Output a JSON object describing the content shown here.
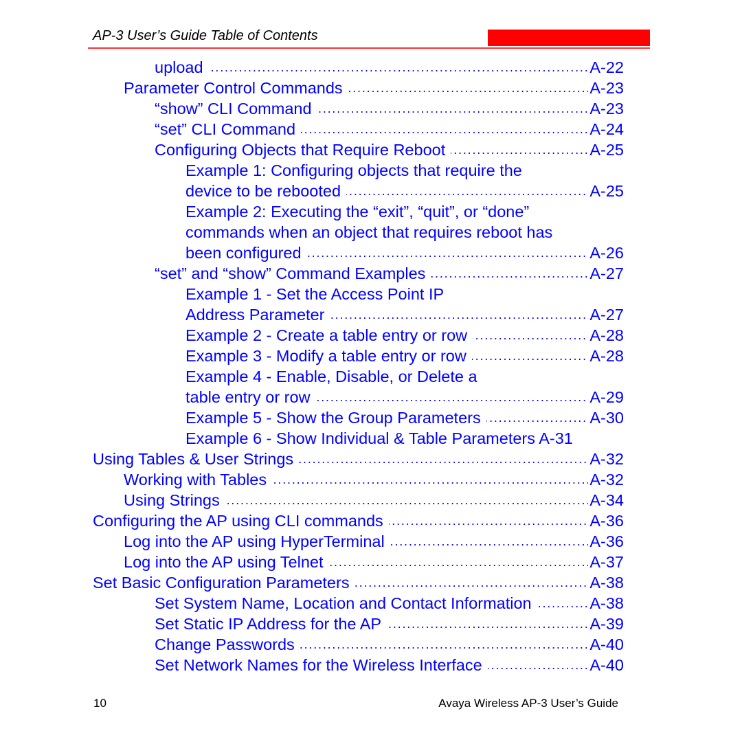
{
  "header": {
    "title": "AP-3 User’s Guide Table of Contents",
    "accent_color": "#ff0000"
  },
  "toc": [
    {
      "text": "upload",
      "page": "A-22",
      "level": 2
    },
    {
      "text": "Parameter Control Commands",
      "page": "A-23",
      "level": 1
    },
    {
      "text": "“show” CLI Command",
      "page": "A-23",
      "level": 2
    },
    {
      "text": "“set” CLI Command",
      "page": "A-24",
      "level": 2
    },
    {
      "text": "Configuring Objects that Require Reboot",
      "page": "A-25",
      "level": 2
    },
    {
      "text": "Example 1: Configuring objects that require the",
      "page": "",
      "level": 3
    },
    {
      "text": "device to be rebooted",
      "page": "A-25",
      "level": 3
    },
    {
      "text": "Example 2: Executing the “exit”, “quit”, or “done”",
      "page": "",
      "level": 3
    },
    {
      "text": "commands when an object that requires reboot has",
      "page": "",
      "level": 3
    },
    {
      "text": "been configured",
      "page": "A-26",
      "level": 3
    },
    {
      "text": "“set” and “show” Command Examples",
      "page": "A-27",
      "level": 2
    },
    {
      "text": "Example 1 - Set the Access Point IP",
      "page": "",
      "level": 3
    },
    {
      "text": "Address Parameter",
      "page": "A-27",
      "level": 3
    },
    {
      "text": "Example 2 - Create a table entry or row",
      "page": "A-28",
      "level": 3
    },
    {
      "text": "Example 3 - Modify a table entry or row",
      "page": "A-28",
      "level": 3
    },
    {
      "text": "Example 4 - Enable, Disable, or Delete a",
      "page": "",
      "level": 3
    },
    {
      "text": "table entry or row",
      "page": "A-29",
      "level": 3
    },
    {
      "text": "Example 5 - Show the Group Parameters",
      "page": "A-30",
      "level": 3
    },
    {
      "text": "Example 6 - Show Individual & Table Parameters  A-31",
      "page": "",
      "level": 3
    },
    {
      "text": "Using Tables & User Strings",
      "page": "A-32",
      "level": 0
    },
    {
      "text": "Working with Tables",
      "page": "A-32",
      "level": 1
    },
    {
      "text": "Using Strings",
      "page": "A-34",
      "level": 1
    },
    {
      "text": "Configuring the AP using CLI commands",
      "page": "A-36",
      "level": 0
    },
    {
      "text": "Log into the AP using HyperTerminal",
      "page": "A-36",
      "level": 1
    },
    {
      "text": "Log into the AP using Telnet",
      "page": "A-37",
      "level": 1
    },
    {
      "text": "Set Basic Configuration Parameters",
      "page": "A-38",
      "level": 0
    },
    {
      "text": "Set System Name, Location and Contact Information",
      "page": "A-38",
      "level": 2
    },
    {
      "text": "Set Static IP Address for the AP",
      "page": "A-39",
      "level": 2
    },
    {
      "text": "Change Passwords",
      "page": "A-40",
      "level": 2
    },
    {
      "text": "Set Network Names for the Wireless Interface",
      "page": "A-40",
      "level": 2
    }
  ],
  "footer": {
    "page_number": "10",
    "title": "Avaya Wireless AP-3 User’s Guide"
  }
}
